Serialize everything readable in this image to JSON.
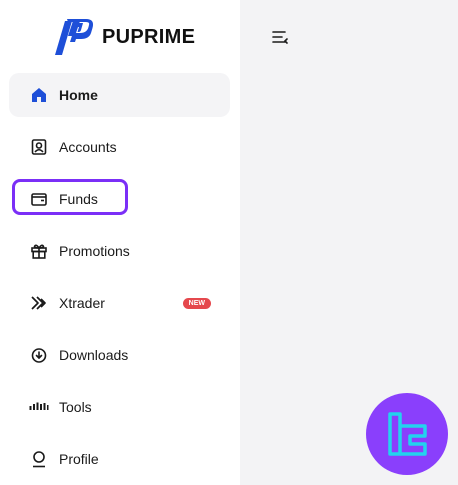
{
  "brand": {
    "name": "PUPRIME",
    "accent": "#1e4fd8"
  },
  "sidebar": {
    "items": [
      {
        "label": "Home",
        "icon": "home-icon",
        "active": true
      },
      {
        "label": "Accounts",
        "icon": "account-icon"
      },
      {
        "label": "Funds",
        "icon": "wallet-icon"
      },
      {
        "label": "Promotions",
        "icon": "gift-icon"
      },
      {
        "label": "Xtrader",
        "icon": "chevrons-right-icon",
        "badge": "NEW"
      },
      {
        "label": "Downloads",
        "icon": "download-cloud-icon"
      },
      {
        "label": "Tools",
        "icon": "signal-bars-icon"
      },
      {
        "label": "Profile",
        "icon": "user-icon"
      }
    ]
  },
  "header": {
    "menu_icon": "menu-collapse-icon"
  },
  "colors": {
    "highlight": "#7b2ff7",
    "badge": "#e5484d",
    "watermark": "#8a3ffc",
    "watermark_mark": "#22d3ee"
  }
}
